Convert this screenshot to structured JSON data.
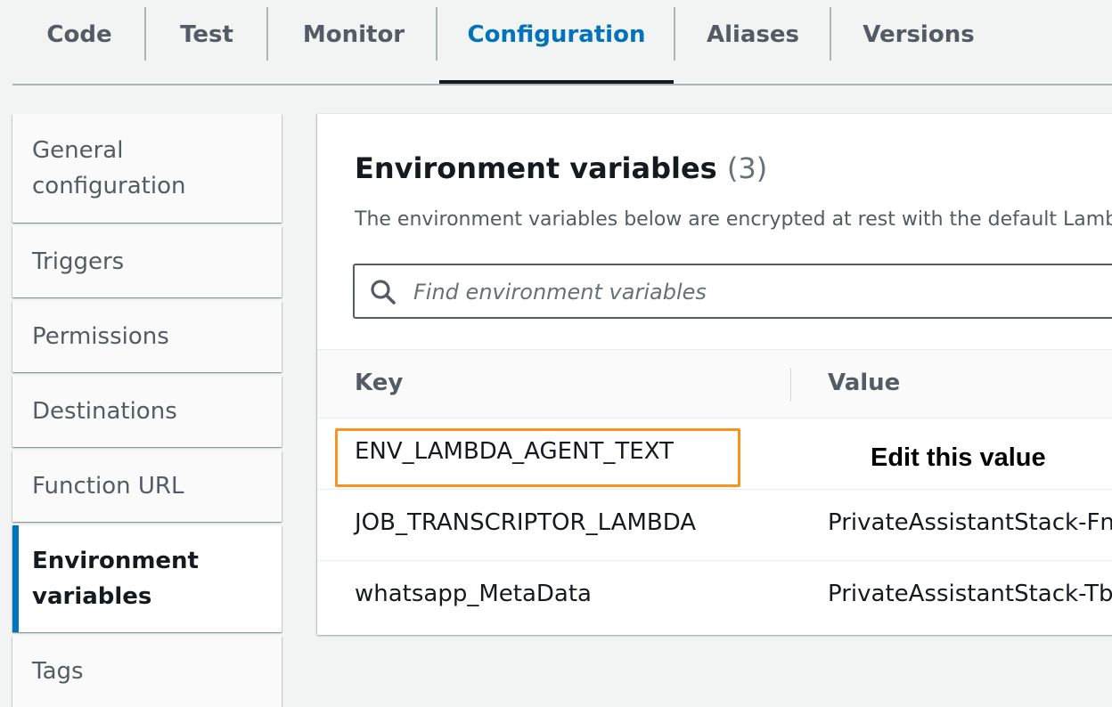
{
  "tabs": [
    {
      "label": "Code"
    },
    {
      "label": "Test"
    },
    {
      "label": "Monitor"
    },
    {
      "label": "Configuration",
      "active": true
    },
    {
      "label": "Aliases"
    },
    {
      "label": "Versions"
    }
  ],
  "sidenav": {
    "items": [
      {
        "label": "General configuration"
      },
      {
        "label": "Triggers"
      },
      {
        "label": "Permissions"
      },
      {
        "label": "Destinations"
      },
      {
        "label": "Function URL"
      },
      {
        "label": "Environment variables",
        "active": true
      },
      {
        "label": "Tags"
      }
    ]
  },
  "panel": {
    "title": "Environment variables",
    "count": "(3)",
    "description": "The environment variables below are encrypted at rest with the default Lambda",
    "search_placeholder": "Find environment variables",
    "search_icon": "search-icon"
  },
  "table": {
    "headers": {
      "key": "Key",
      "value": "Value"
    },
    "rows": [
      {
        "key": "ENV_LAMBDA_AGENT_TEXT",
        "value": ""
      },
      {
        "key": "JOB_TRANSCRIPTOR_LAMBDA",
        "value": "PrivateAssistantStack-Fna"
      },
      {
        "key": "whatsapp_MetaData",
        "value": "PrivateAssistantStack-Tbl"
      }
    ]
  },
  "annotation": {
    "text": "Edit this value",
    "box_color": "#f7931e"
  },
  "colors": {
    "accent": "#0073bb",
    "highlight": "#f7931e"
  }
}
